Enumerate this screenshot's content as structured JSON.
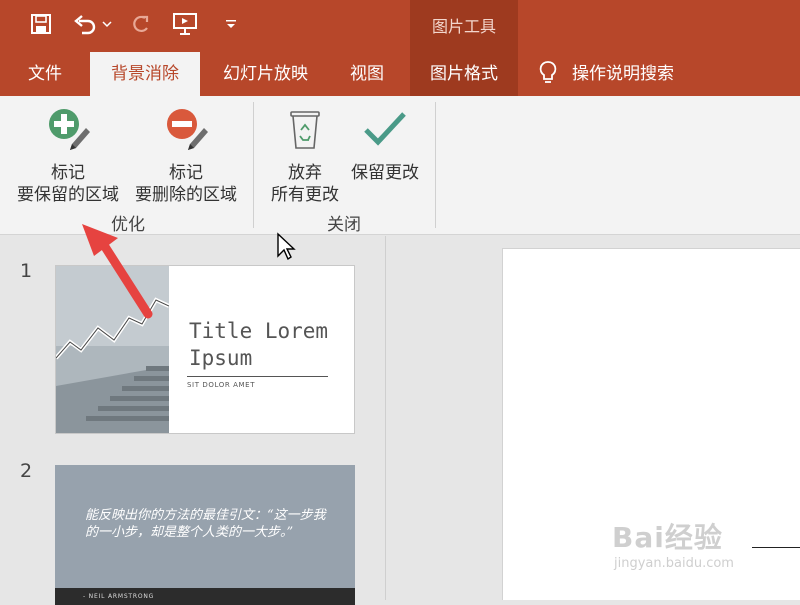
{
  "quick_access": {
    "icons": [
      "save-icon",
      "undo-icon",
      "undo-dropdown-icon",
      "redo-icon",
      "present-from-start-icon",
      "customize-qat-icon"
    ]
  },
  "context_tab": {
    "label": "图片工具"
  },
  "tabs": [
    {
      "label": "文件",
      "active": false
    },
    {
      "label": "背景消除",
      "active": true
    },
    {
      "label": "幻灯片放映",
      "active": false
    },
    {
      "label": "视图",
      "active": false
    },
    {
      "label": "图片格式",
      "active": false
    }
  ],
  "tell_me": {
    "label": "操作说明搜索",
    "icon": "lightbulb-icon"
  },
  "ribbon": {
    "groups": [
      {
        "label": "优化",
        "buttons": [
          {
            "line1": "标记",
            "line2": "要保留的区域",
            "icon": "mark-keep-icon"
          },
          {
            "line1": "标记",
            "line2": "要删除的区域",
            "icon": "mark-remove-icon"
          }
        ]
      },
      {
        "label": "关闭",
        "buttons": [
          {
            "line1": "放弃",
            "line2": "所有更改",
            "icon": "discard-icon"
          },
          {
            "line1": "保留更改",
            "line2": "",
            "icon": "keep-changes-icon"
          }
        ]
      }
    ]
  },
  "slides": [
    {
      "number": "1",
      "title_line1": "Title Lorem",
      "title_line2": "Ipsum",
      "subtitle": "SIT DOLOR AMET"
    },
    {
      "number": "2",
      "quote": "能反映出你的方法的最佳引文：“这一步我的一小步，却是整个人类的一大步。”",
      "author": "- NEIL ARMSTRONG"
    }
  ],
  "watermark": {
    "line1": "Bai经验",
    "line2": "jingyan.baidu.com"
  },
  "colors": {
    "accent": "#b7472a",
    "accent_dark": "#9e3a1f",
    "ribbon_bg": "#f3f3f3",
    "plus_green": "#4f9b6b",
    "minus_red": "#d9593c",
    "check_teal": "#4a9a88"
  }
}
